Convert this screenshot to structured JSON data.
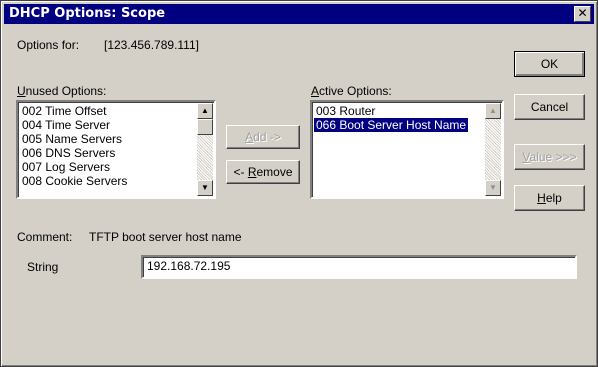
{
  "window": {
    "title": "DHCP Options: Scope",
    "close_glyph": "✕"
  },
  "options_for": {
    "label": "Options for:",
    "value": "[123.456.789.111]"
  },
  "unused": {
    "label_prefix": "U",
    "label_rest": "nused Options:",
    "items": [
      "002 Time Offset",
      "004 Time Server",
      "005 Name Servers",
      "006 DNS Servers",
      "007 Log Servers",
      "008 Cookie Servers"
    ]
  },
  "active": {
    "label_prefix": "A",
    "label_rest": "ctive Options:",
    "items": [
      "003 Router",
      "066 Boot Server Host Name"
    ],
    "selected_index": 1
  },
  "buttons": {
    "add": {
      "before": "",
      "accel": "A",
      "after": "dd ->"
    },
    "remove": {
      "before": "<- ",
      "accel": "R",
      "after": "emove"
    },
    "ok": "OK",
    "cancel": "Cancel",
    "value": {
      "accel": "V",
      "after": "alue >>>"
    },
    "help": {
      "accel": "H",
      "after": "elp"
    }
  },
  "comment": {
    "label": "Comment:",
    "text": "TFTP boot server host name"
  },
  "string_field": {
    "label": "String",
    "value": "192.168.72.195"
  },
  "icons": {
    "scroll_up": "up-arrow-icon",
    "scroll_down": "down-arrow-icon",
    "close": "close-icon"
  }
}
